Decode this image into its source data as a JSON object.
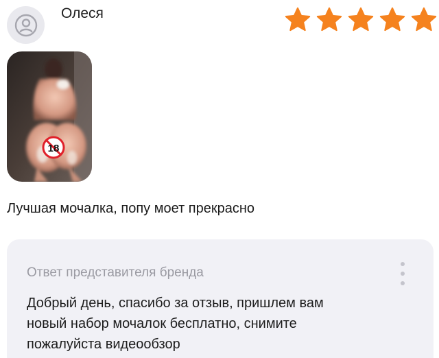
{
  "review": {
    "author": "Олеся",
    "rating": 5,
    "rating_max": 5,
    "star_color": "#f5821e",
    "avatar_icon": "user-icon",
    "photo_badge": "18",
    "text": "Лучшая мочалка, попу моет прекрасно"
  },
  "brand_reply": {
    "label": "Ответ представителя бренда",
    "lines": [
      "Добрый день, спасибо за отзыв, пришлем вам",
      "новый набор мочалок бесплатно, снимите",
      "пожалуйста видеообзор"
    ],
    "menu_icon": "more-vertical-icon"
  }
}
